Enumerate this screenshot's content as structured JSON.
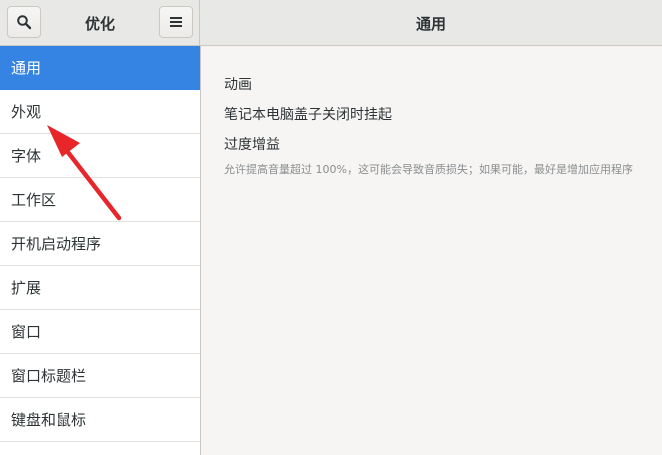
{
  "header": {
    "app_title": "优化",
    "page_title": "通用",
    "search_icon": "search-icon",
    "menu_icon": "hamburger-menu-icon"
  },
  "sidebar": {
    "items": [
      {
        "label": "通用",
        "selected": true
      },
      {
        "label": "外观",
        "selected": false
      },
      {
        "label": "字体",
        "selected": false
      },
      {
        "label": "工作区",
        "selected": false
      },
      {
        "label": "开机启动程序",
        "selected": false
      },
      {
        "label": "扩展",
        "selected": false
      },
      {
        "label": "窗口",
        "selected": false
      },
      {
        "label": "窗口标题栏",
        "selected": false
      },
      {
        "label": "键盘和鼠标",
        "selected": false
      }
    ]
  },
  "main": {
    "settings": [
      {
        "label": "动画"
      },
      {
        "label": "笔记本电脑盖子关闭时挂起"
      },
      {
        "label": "过度增益",
        "description": "允许提高音量超过 100%，这可能会导致音质损失；如果可能，最好是增加应用程序"
      }
    ]
  },
  "colors": {
    "accent": "#3584e4",
    "annotation_arrow": "#e8262a"
  }
}
